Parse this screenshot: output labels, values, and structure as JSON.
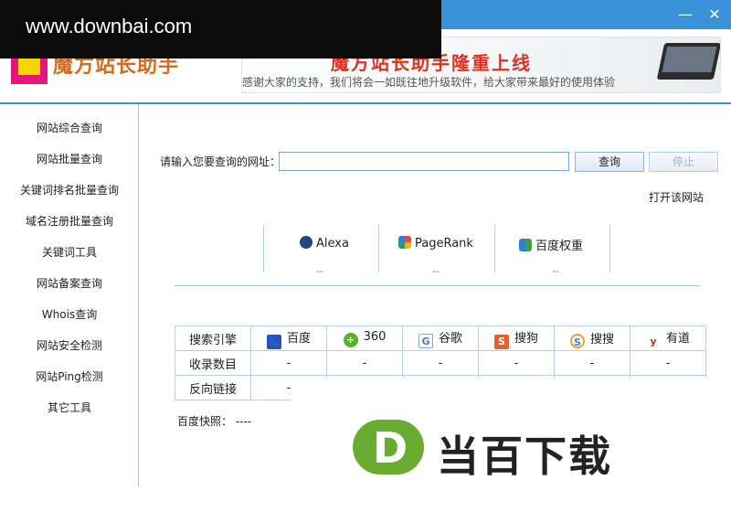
{
  "window": {
    "minimize": "—",
    "close": "✕"
  },
  "watermark": {
    "site": "www.downbai.com",
    "brand": "当百下载",
    "d_letter": "D"
  },
  "logo": {
    "text": "魔方站长助手"
  },
  "banner": {
    "title": "魔方站长助手隆重上线",
    "subtitle": "感谢大家的支持，我们将会一如既往地升级软件，给大家带来最好的使用体验"
  },
  "sidebar": {
    "items": [
      {
        "label": "网站综合查询"
      },
      {
        "label": "网站批量查询"
      },
      {
        "label": "关键词排名批量查询"
      },
      {
        "label": "域名注册批量查询"
      },
      {
        "label": "关键词工具"
      },
      {
        "label": "网站备案查询"
      },
      {
        "label": "Whois查询"
      },
      {
        "label": "网站安全检测"
      },
      {
        "label": "网站Ping检测"
      },
      {
        "label": "其它工具"
      }
    ]
  },
  "search": {
    "label": "请输入您要查询的网址：",
    "value": "",
    "query_button": "查询",
    "stop_button": "停止",
    "open_site": "打开该网站"
  },
  "ranks": [
    {
      "name": "Alexa",
      "value": "--",
      "icon": "alexa-icon"
    },
    {
      "name": "PageRank",
      "value": "--",
      "icon": "pagerank-icon"
    },
    {
      "name": "百度权重",
      "value": "--",
      "icon": "baidu-weight-icon"
    }
  ],
  "engines": {
    "header": "搜索引擎",
    "columns": [
      {
        "name": "百度",
        "icon": "baidu-icon",
        "color": "#2b4fbf",
        "glyph": "🐾"
      },
      {
        "name": "360",
        "icon": "so360-icon",
        "color": "#5cae2f",
        "glyph": "+"
      },
      {
        "name": "谷歌",
        "icon": "google-icon",
        "color": "#4a79c4",
        "glyph": "G"
      },
      {
        "name": "搜狗",
        "icon": "sogou-icon",
        "color": "#e2622b",
        "glyph": "S"
      },
      {
        "name": "搜搜",
        "icon": "soso-icon",
        "color": "#2e8bd0",
        "glyph": "S"
      },
      {
        "name": "有道",
        "icon": "youdao-icon",
        "color": "#d8261f",
        "glyph": "y"
      }
    ],
    "rows": [
      {
        "label": "收录数目",
        "values": [
          "-",
          "-",
          "-",
          "-",
          "-",
          "-"
        ]
      },
      {
        "label": "反向链接",
        "values": [
          "-",
          "",
          "",
          "",
          "",
          ""
        ]
      }
    ]
  },
  "snapshot": {
    "label": "百度快照：",
    "value": "----"
  }
}
